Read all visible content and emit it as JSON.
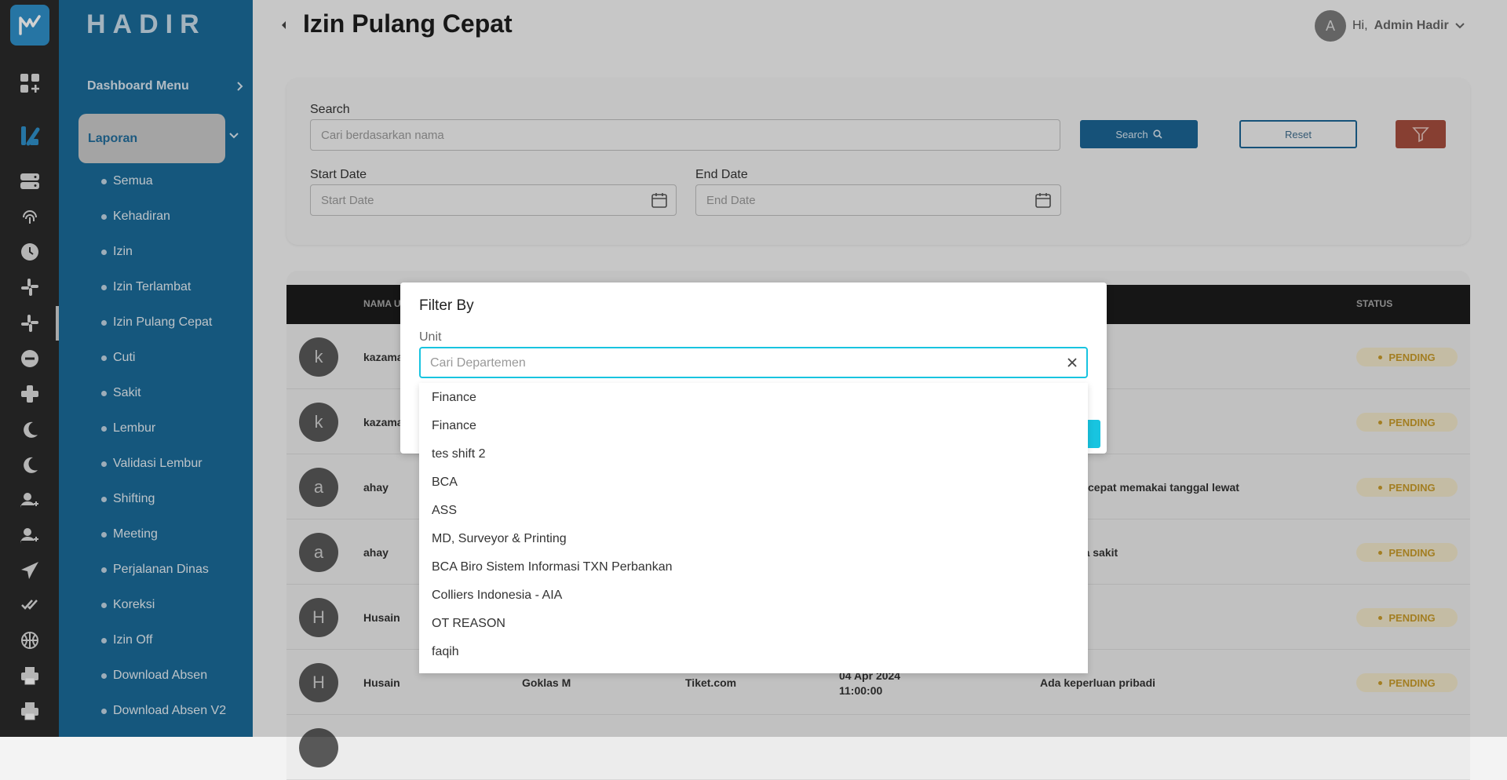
{
  "sidebar": {
    "brand": "HADIR",
    "dashboard_menu": "Dashboard Menu",
    "laporan": "Laporan",
    "items": [
      "Semua",
      "Kehadiran",
      "Izin",
      "Izin Terlambat",
      "Izin Pulang Cepat",
      "Cuti",
      "Sakit",
      "Lembur",
      "Validasi Lembur",
      "Shifting",
      "Meeting",
      "Perjalanan Dinas",
      "Koreksi",
      "Izin Off",
      "Download Absen",
      "Download Absen V2"
    ]
  },
  "header": {
    "title": "Izin Pulang Cepat",
    "avatar_letter": "A",
    "greeting": "Hi,",
    "user_name": "Admin Hadir"
  },
  "search_card": {
    "search_label": "Search",
    "search_placeholder": "Cari berdasarkan nama",
    "search_button": "Search",
    "reset_button": "Reset",
    "start_label": "Start Date",
    "start_placeholder": "Start Date",
    "end_label": "End Date",
    "end_placeholder": "End Date"
  },
  "table": {
    "col_name": "NAMA U",
    "col_status": "STATUS",
    "rows": [
      {
        "letter": "k",
        "name": "kazama",
        "reason": "",
        "status": "PENDING"
      },
      {
        "letter": "k",
        "name": "kazama",
        "reason": "",
        "status": "PENDING"
      },
      {
        "letter": "a",
        "name": "ahay",
        "reason": "ng cepat memakai tanggal lewat",
        "status": "PENDING"
      },
      {
        "letter": "a",
        "name": "ahay",
        "reason": "aya sakit",
        "status": "PENDING"
      },
      {
        "letter": "H",
        "name": "Husain",
        "reason": "",
        "status": "PENDING"
      },
      {
        "letter": "H",
        "name": "Husain",
        "approver": "Goklas M",
        "unit": "Tiket.com",
        "date": "04 Apr 2024",
        "time": "11:00:00",
        "reason": "Ada keperluan pribadi",
        "status": "PENDING"
      }
    ]
  },
  "modal": {
    "title": "Filter By",
    "unit_label": "Unit",
    "unit_placeholder": "Cari Departemen",
    "options": [
      "Finance",
      "Finance",
      "tes shift 2",
      "BCA",
      "ASS",
      "MD, Surveyor & Printing",
      "BCA Biro Sistem Informasi TXN Perbankan",
      "Colliers Indonesia - AIA",
      "OT REASON",
      "faqih"
    ]
  },
  "colors": {
    "sidebar": "#1a6b99",
    "rail": "#2a2a2a",
    "accent_cyan": "#18c4e0",
    "filter_button": "#a54e3e",
    "pending": "#c79a2a"
  }
}
